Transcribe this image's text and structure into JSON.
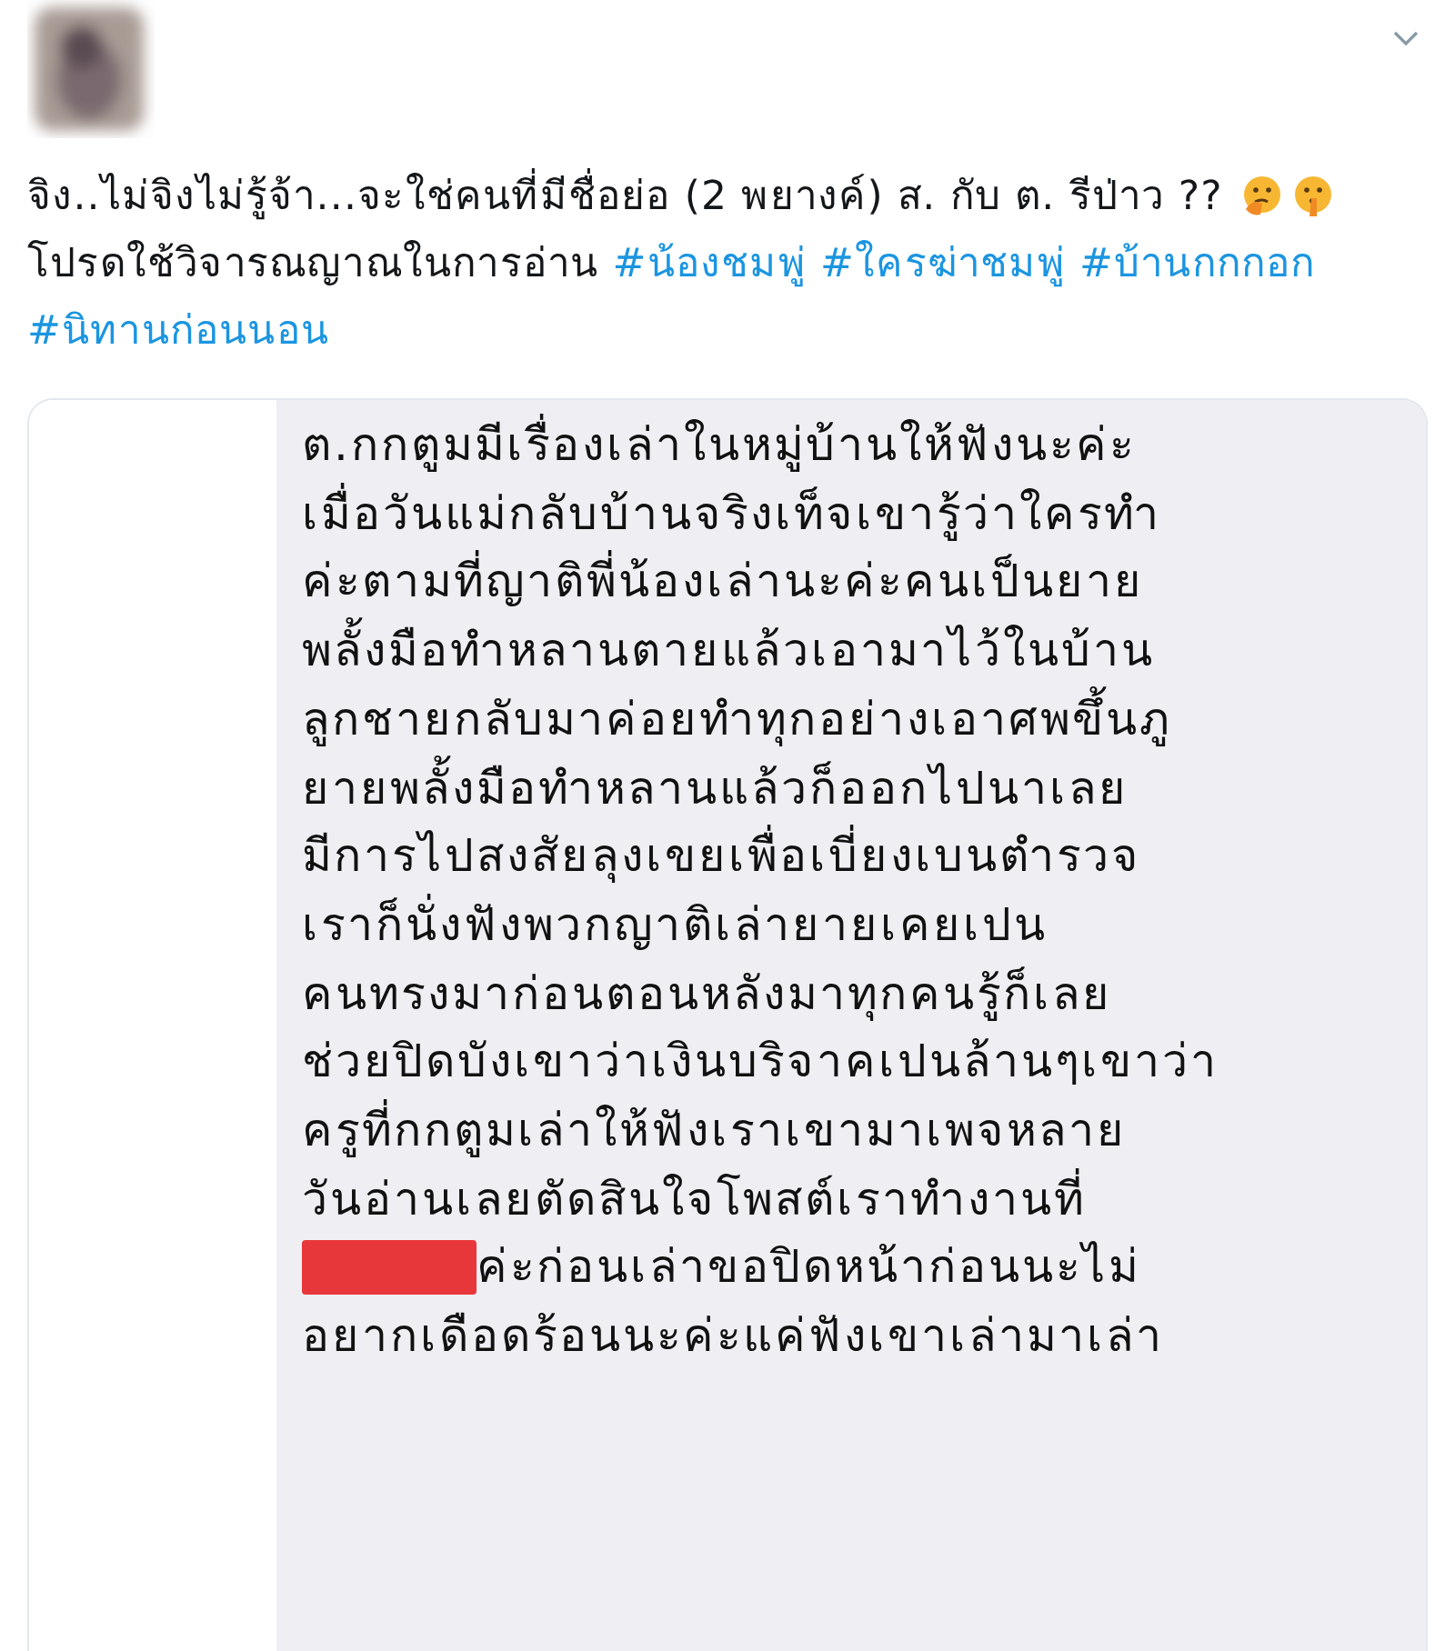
{
  "tweet": {
    "body": [
      {
        "kind": "text",
        "text": "จิง..ไม่จิงไม่รู้จ้า...จะใช่คนที่มีชื่อย่อ (2 พยางค์) ส. กับ ต. รีป่าว ??"
      },
      {
        "kind": "emoji"
      },
      {
        "kind": "emoji"
      },
      {
        "kind": "text",
        "text": "โปรดใช้วิจารณญาณในการอ่าน"
      },
      {
        "kind": "hashtag",
        "text": "#น้องชมพู่"
      },
      {
        "kind": "hashtag",
        "text": "#ใครฆ่าชมพู่"
      },
      {
        "kind": "hashtag",
        "text": "#บ้านกกกอก"
      },
      {
        "kind": "hashtag",
        "text": "#นิทานก่อนนอน"
      }
    ],
    "image": {
      "kind": "note",
      "lines": [
        {
          "text": "ต.กกตูมมีเรื่องเล่าในหมู่บ้านให้ฟังนะค่ะ",
          "redacted": false
        },
        {
          "text": "เมื่อวันแม่กลับบ้านจริงเท็จเขารู้ว่าใครทำ",
          "redacted": false
        },
        {
          "text": "ค่ะตามที่ญาติพี่น้องเล่านะค่ะคนเป็นยาย",
          "redacted": false
        },
        {
          "text": "พลั้งมือทำหลานตายแล้วเอามาไว้ในบ้าน",
          "redacted": false
        },
        {
          "text": "ลูกชายกลับมาค่อยทำทุกอย่างเอาศพขึ้นภู",
          "redacted": false
        },
        {
          "text": "ยายพลั้งมือทำหลานแล้วก็ออกไปนาเลย",
          "redacted": false
        },
        {
          "text": "มีการไปสงสัยลุงเขยเพื่อเบี่ยงเบนตำรวจ",
          "redacted": false
        },
        {
          "text": "เราก็นั่งฟังพวกญาติเล่ายายเคยเปน",
          "redacted": false
        },
        {
          "text": "คนทรงมาก่อนตอนหลังมาทุกคนรู้ก็เลย",
          "redacted": false
        },
        {
          "text": "ช่วยปิดบังเขาว่าเงินบริจาคเปนล้านๆเขาว่า",
          "redacted": false
        },
        {
          "text": "ครูที่กกตูมเล่าให้ฟังเราเขามาเพจหลาย",
          "redacted": false
        },
        {
          "text": "วันอ่านเลยตัดสินใจโพสต์เราทำงานที่",
          "redacted": false
        },
        {
          "text": "ค่ะก่อนเล่าขอปิดหน้าก่อนนะไม่",
          "redacted": true
        },
        {
          "text": "อยากเดือดร้อนนะค่ะแค่ฟังเขาเล่ามาเล่า",
          "redacted": false
        }
      ]
    }
  }
}
